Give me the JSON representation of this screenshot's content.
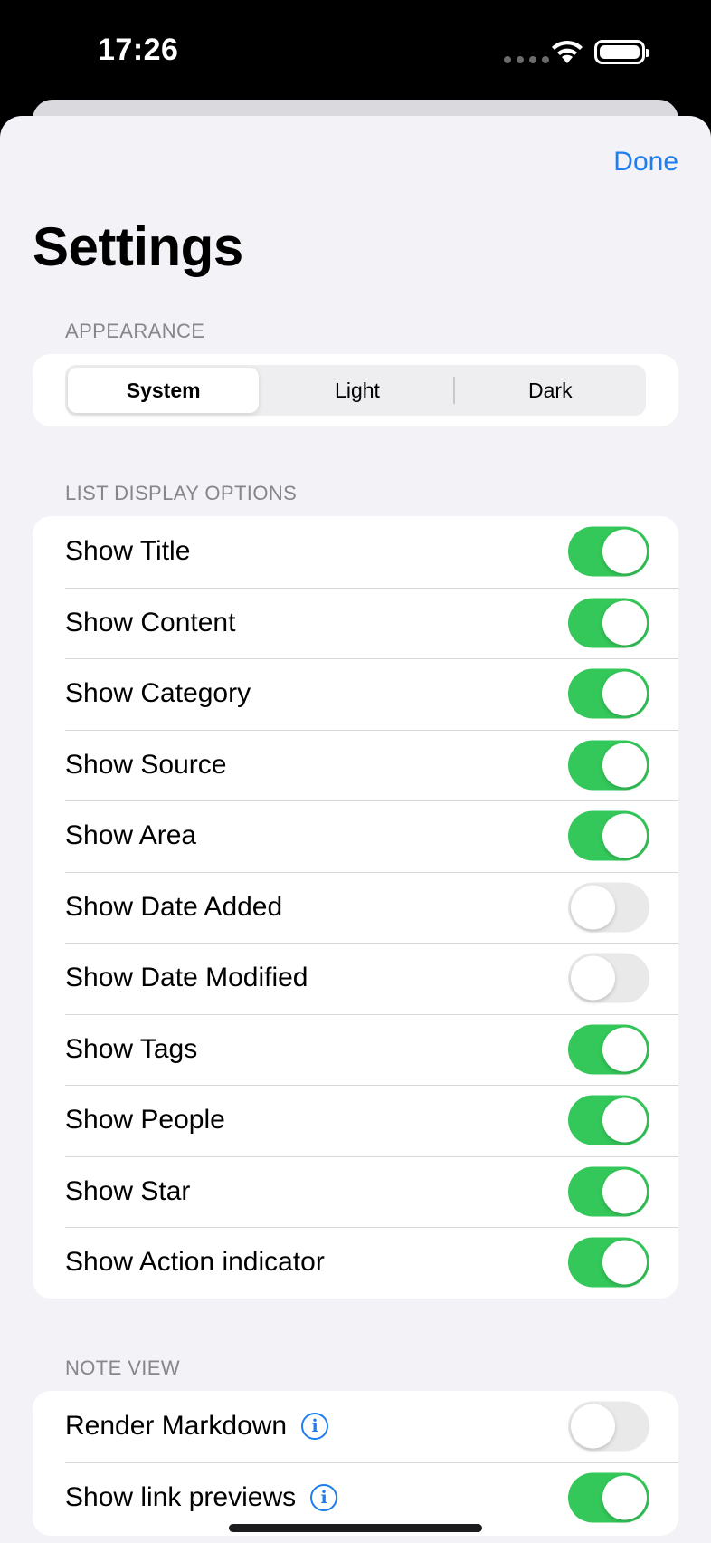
{
  "status_bar": {
    "time": "17:26"
  },
  "header": {
    "done_label": "Done",
    "title": "Settings"
  },
  "appearance": {
    "header": "APPEARANCE",
    "options": [
      "System",
      "Light",
      "Dark"
    ],
    "selected": "System"
  },
  "list_display": {
    "header": "LIST DISPLAY OPTIONS",
    "items": [
      {
        "label": "Show Title",
        "on": true
      },
      {
        "label": "Show Content",
        "on": true
      },
      {
        "label": "Show Category",
        "on": true
      },
      {
        "label": "Show Source",
        "on": true
      },
      {
        "label": "Show Area",
        "on": true
      },
      {
        "label": "Show Date Added",
        "on": false
      },
      {
        "label": "Show Date Modified",
        "on": false
      },
      {
        "label": "Show Tags",
        "on": true
      },
      {
        "label": "Show People",
        "on": true
      },
      {
        "label": "Show Star",
        "on": true
      },
      {
        "label": "Show Action indicator",
        "on": true
      }
    ]
  },
  "note_view": {
    "header": "NOTE VIEW",
    "items": [
      {
        "label": "Render Markdown",
        "on": false,
        "icon": "info-icon"
      },
      {
        "label": "Show link previews",
        "on": true,
        "icon": "info-icon"
      }
    ]
  },
  "colors": {
    "accent": "#1e7df0",
    "toggle_on": "#34c759",
    "background": "#f2f2f7"
  }
}
